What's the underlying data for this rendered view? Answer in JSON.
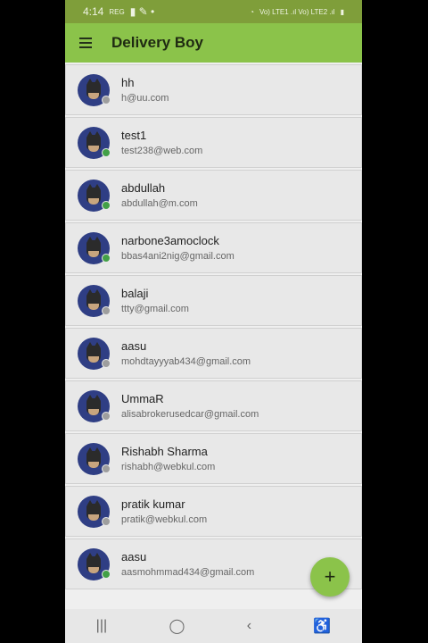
{
  "status": {
    "time": "4:14",
    "mini_label": "REG",
    "right_text": "Vo) LTE1 .ıl Vo) LTE2 .ıl"
  },
  "app": {
    "title": "Delivery Boy",
    "fab": "+"
  },
  "colors": {
    "online": "#43a047",
    "offline": "#9e9e9e"
  },
  "items": [
    {
      "name": "hh",
      "email": "h@uu.com",
      "status": "offline"
    },
    {
      "name": "test1",
      "email": "test238@web.com",
      "status": "online"
    },
    {
      "name": "abdullah",
      "email": "abdullah@m.com",
      "status": "online"
    },
    {
      "name": "narbone3amoclock",
      "email": "bbas4ani2nig@gmail.com",
      "status": "online"
    },
    {
      "name": "balaji",
      "email": "ttty@gmail.com",
      "status": "offline"
    },
    {
      "name": "aasu",
      "email": "mohdtayyyab434@gmail.com",
      "status": "offline"
    },
    {
      "name": "UmmaR",
      "email": "alisabrokerusedcar@gmail.com",
      "status": "offline"
    },
    {
      "name": "Rishabh Sharma",
      "email": "rishabh@webkul.com",
      "status": "offline"
    },
    {
      "name": "pratik kumar",
      "email": "pratik@webkul.com",
      "status": "offline"
    },
    {
      "name": "aasu",
      "email": "aasmohmmad434@gmail.com",
      "status": "online"
    }
  ],
  "nav": {
    "recent": "|||",
    "home": "◯",
    "back": "‹",
    "accessibility": "♿"
  }
}
